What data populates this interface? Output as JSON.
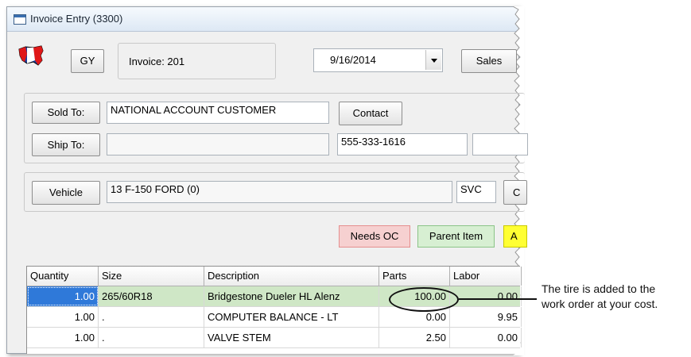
{
  "window": {
    "title": "Invoice Entry (3300)"
  },
  "header": {
    "store_button": "GY",
    "invoice_label": "Invoice: 201",
    "date": "9/16/2014",
    "sales_button": "Sales"
  },
  "customer": {
    "sold_to_button": "Sold To:",
    "sold_to_value": "NATIONAL ACCOUNT CUSTOMER",
    "contact_button": "Contact",
    "ship_to_button": "Ship To:",
    "ship_to_value": "",
    "phone": "555-333-1616"
  },
  "vehicle": {
    "button": "Vehicle",
    "value": "13 F-150 FORD  (0)",
    "svc": "SVC",
    "cut_button": "C"
  },
  "tags": {
    "needs_oc": "Needs OC",
    "parent_item": "Parent Item",
    "cut_tag": "A"
  },
  "grid": {
    "columns": [
      "Quantity",
      "Size",
      "Description",
      "Parts",
      "Labor"
    ],
    "rows": [
      {
        "quantity": "1.00",
        "size": "265/60R18",
        "description": "Bridgestone Dueler HL Alenz",
        "parts": "100.00",
        "labor": "0.00"
      },
      {
        "quantity": "1.00",
        "size": ".",
        "description": "COMPUTER BALANCE - LT",
        "parts": "0.00",
        "labor": "9.95"
      },
      {
        "quantity": "1.00",
        "size": ".",
        "description": "VALVE STEM",
        "parts": "2.50",
        "labor": "0.00"
      }
    ]
  },
  "callout": {
    "line1": "The tire is added to the",
    "line2": "work order at your cost."
  },
  "colors": {
    "selected_row": "#cfe7c6",
    "selected_cell": "#2f79d9",
    "needs_oc_bg": "#f6d0d0",
    "parent_item_bg": "#d7efd2",
    "yellow_tag": "#ffff33"
  }
}
